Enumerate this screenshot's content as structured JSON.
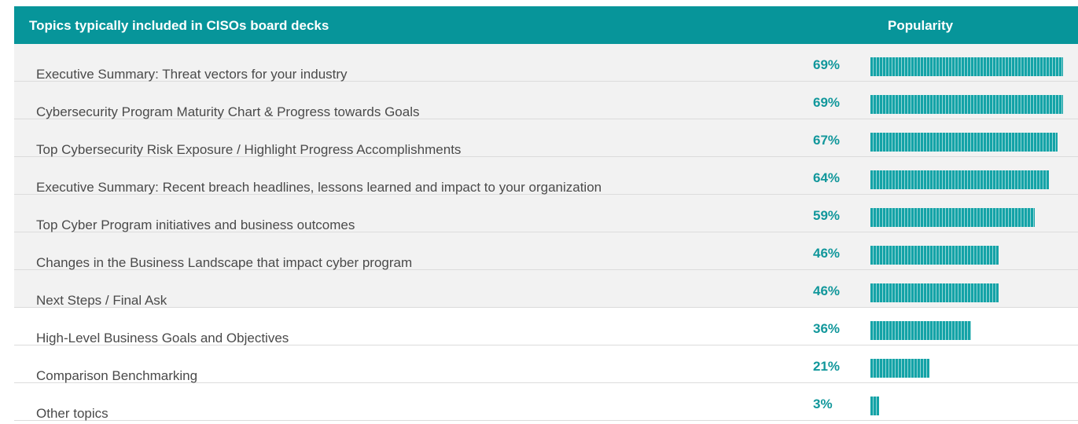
{
  "header": {
    "title": "Topics typically included in CISOs board decks",
    "popularity": "Popularity"
  },
  "colors": {
    "header_bg": "#07959a",
    "bar": "#14a3a7",
    "percent_text": "#11979b",
    "row_shade": "#f2f2f2"
  },
  "chart_data": {
    "type": "bar",
    "orientation": "horizontal",
    "categories": [
      "Executive Summary: Threat vectors for your industry",
      "Cybersecurity Program Maturity Chart & Progress towards Goals",
      "Top Cybersecurity Risk Exposure / Highlight Progress Accomplishments",
      "Executive Summary: Recent breach headlines, lessons learned and impact to your organization",
      "Top Cyber Program initiatives and business outcomes",
      "Changes in the Business Landscape that impact cyber program",
      "Next Steps / Final Ask",
      "High-Level Business Goals and Objectives",
      "Comparison Benchmarking",
      "Other topics"
    ],
    "values": [
      69,
      69,
      67,
      64,
      59,
      46,
      46,
      36,
      21,
      3
    ],
    "labels": [
      "69%",
      "69%",
      "67%",
      "64%",
      "59%",
      "46%",
      "46%",
      "36%",
      "21%",
      "3%"
    ],
    "title": "Topics typically included in CISOs board decks",
    "value_header": "Popularity",
    "xlim": [
      0,
      69
    ]
  }
}
